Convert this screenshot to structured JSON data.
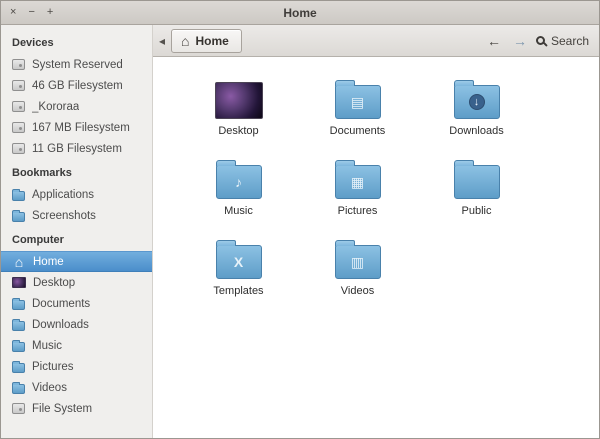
{
  "window": {
    "title": "Home",
    "controls": [
      {
        "name": "close",
        "glyph": "×"
      },
      {
        "name": "minimize",
        "glyph": "−"
      },
      {
        "name": "maximize",
        "glyph": "+"
      }
    ]
  },
  "sidebar": {
    "sections": [
      {
        "title": "Devices",
        "items": [
          {
            "label": "System Reserved",
            "icon": "drive"
          },
          {
            "label": "46 GB Filesystem",
            "icon": "drive"
          },
          {
            "label": "_Kororaa",
            "icon": "drive"
          },
          {
            "label": "167 MB Filesystem",
            "icon": "drive"
          },
          {
            "label": "11 GB Filesystem",
            "icon": "drive"
          }
        ]
      },
      {
        "title": "Bookmarks",
        "items": [
          {
            "label": "Applications",
            "icon": "folder"
          },
          {
            "label": "Screenshots",
            "icon": "folder"
          }
        ]
      },
      {
        "title": "Computer",
        "items": [
          {
            "label": "Home",
            "icon": "home",
            "selected": true
          },
          {
            "label": "Desktop",
            "icon": "desktop"
          },
          {
            "label": "Documents",
            "icon": "folder"
          },
          {
            "label": "Downloads",
            "icon": "folder"
          },
          {
            "label": "Music",
            "icon": "folder"
          },
          {
            "label": "Pictures",
            "icon": "folder"
          },
          {
            "label": "Videos",
            "icon": "folder"
          },
          {
            "label": "File System",
            "icon": "filesystem"
          }
        ]
      }
    ]
  },
  "toolbar": {
    "path_scroll_glyph": "◂",
    "breadcrumb": "Home",
    "home_icon_glyph": "⌂",
    "back_glyph": "←",
    "forward_glyph": "→",
    "search_label": "Search"
  },
  "files": [
    {
      "label": "Desktop",
      "type": "thumbnail"
    },
    {
      "label": "Documents",
      "type": "folder",
      "emblem": "▤"
    },
    {
      "label": "Downloads",
      "type": "folder",
      "emblem": "↓",
      "emblem_style": "circle"
    },
    {
      "label": "Music",
      "type": "folder",
      "emblem": "♪"
    },
    {
      "label": "Pictures",
      "type": "folder",
      "emblem": "▦"
    },
    {
      "label": "Public",
      "type": "folder",
      "emblem": ""
    },
    {
      "label": "Templates",
      "type": "folder",
      "emblem": "X"
    },
    {
      "label": "Videos",
      "type": "folder",
      "emblem": "▥"
    }
  ],
  "colors": {
    "selection": "#4b8ecb",
    "folder_blue": "#6fa7cf",
    "titlebar": "#d5d2ce"
  }
}
